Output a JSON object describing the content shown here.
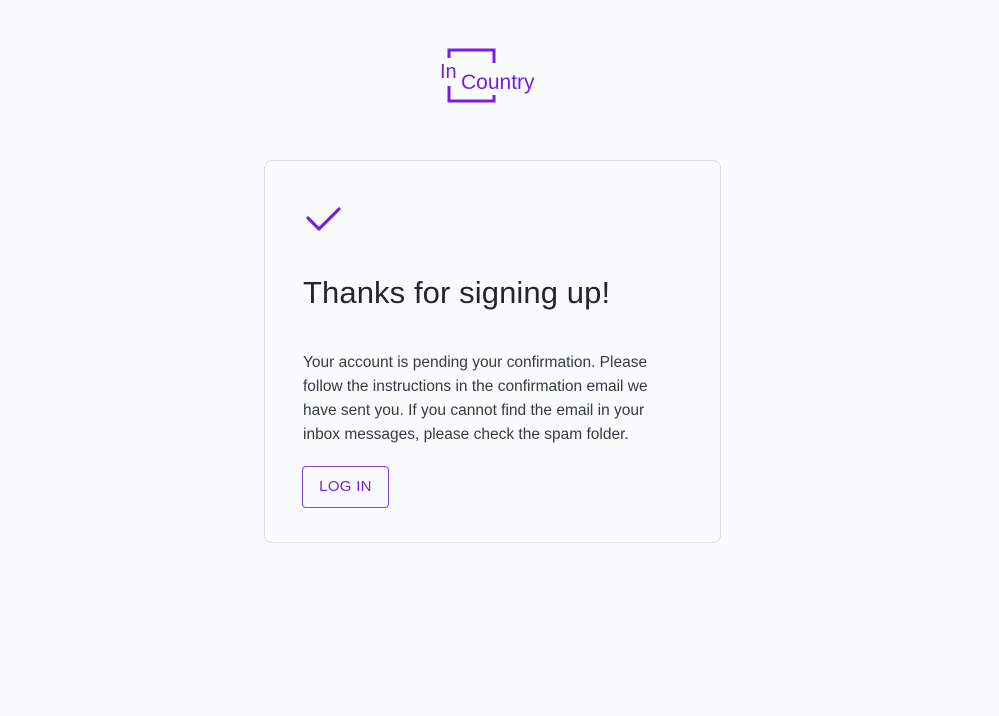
{
  "brand": {
    "logo_prefix": "In",
    "logo_word": "Country",
    "accent_color": "#7b1de0"
  },
  "card": {
    "icon": "checkmark-icon",
    "title": "Thanks for signing up!",
    "message": "Your account is pending your confirmation. Please follow the instructions in the confirmation email we have sent you. If you cannot find the email in your inbox messages, please check the spam folder.",
    "login_label": "LOG IN"
  }
}
